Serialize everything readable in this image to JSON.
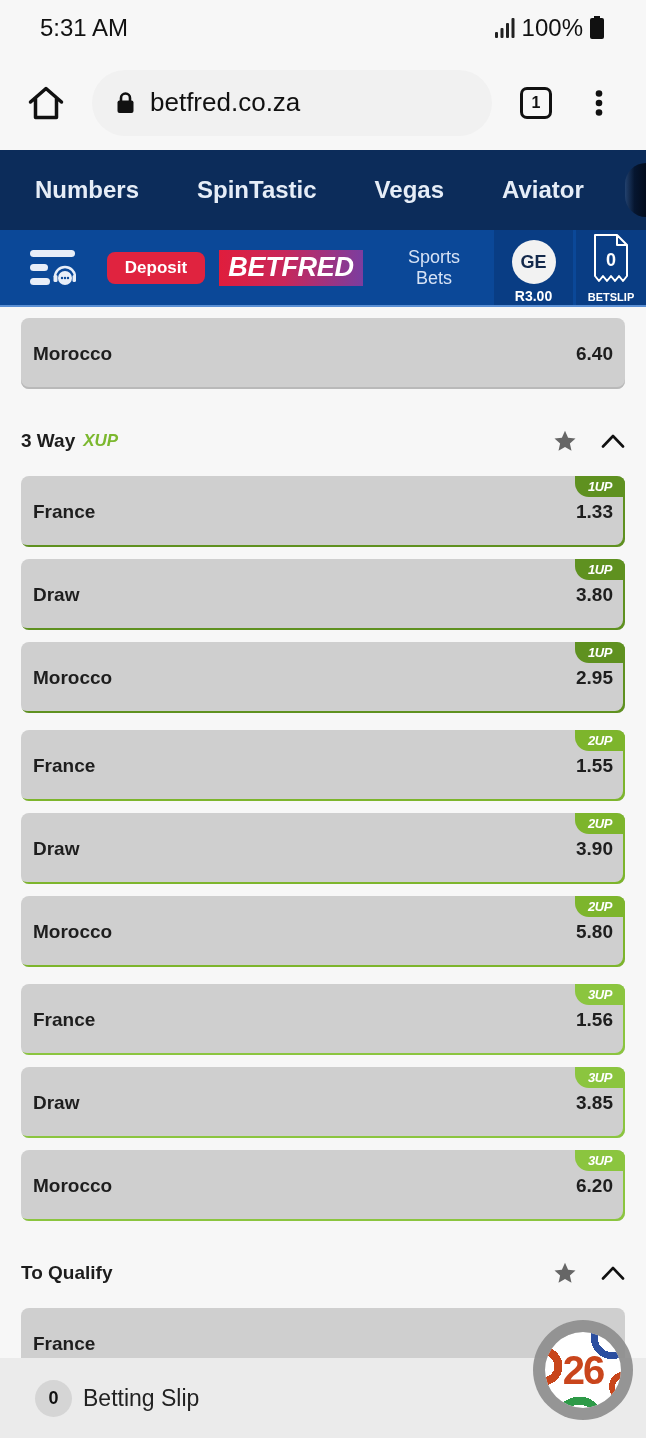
{
  "status_bar": {
    "time": "5:31 AM",
    "battery": "100%"
  },
  "browser": {
    "url": "betfred.co.za",
    "tab_count": "1"
  },
  "top_nav": {
    "items": [
      "Numbers",
      "SpinTastic",
      "Vegas",
      "Aviator"
    ]
  },
  "site_header": {
    "deposit": "Deposit",
    "logo": "BETFRED",
    "sports_link": "Sports Bets",
    "account_initials": "GE",
    "balance": "R3.00",
    "betslip_count": "0",
    "betslip_label": "BETSLIP"
  },
  "markets": [
    {
      "groups": [
        {
          "rows": [
            {
              "name": "Morocco",
              "odds": "6.40"
            }
          ]
        }
      ]
    },
    {
      "title": "3 Way",
      "tag": "XUP",
      "favorite": false,
      "expanded": true,
      "groups": [
        {
          "rows": [
            {
              "name": "France",
              "odds": "1.33",
              "badge": "1UP",
              "color": "#5f9120"
            },
            {
              "name": "Draw",
              "odds": "3.80",
              "badge": "1UP",
              "color": "#5f9120"
            },
            {
              "name": "Morocco",
              "odds": "2.95",
              "badge": "1UP",
              "color": "#5f9120"
            }
          ]
        },
        {
          "rows": [
            {
              "name": "France",
              "odds": "1.55",
              "badge": "2UP",
              "color": "#7db52c"
            },
            {
              "name": "Draw",
              "odds": "3.90",
              "badge": "2UP",
              "color": "#7db52c"
            },
            {
              "name": "Morocco",
              "odds": "5.80",
              "badge": "2UP",
              "color": "#7db52c"
            }
          ]
        },
        {
          "rows": [
            {
              "name": "France",
              "odds": "1.56",
              "badge": "3UP",
              "color": "#8bc53f"
            },
            {
              "name": "Draw",
              "odds": "3.85",
              "badge": "3UP",
              "color": "#8bc53f"
            },
            {
              "name": "Morocco",
              "odds": "6.20",
              "badge": "3UP",
              "color": "#8bc53f"
            }
          ]
        }
      ]
    },
    {
      "title": "To Qualify",
      "favorite": false,
      "expanded": true,
      "groups": [
        {
          "rows": [
            {
              "name": "France"
            }
          ]
        }
      ]
    }
  ],
  "betting_slip_bar": {
    "count": "0",
    "label": "Betting Slip"
  },
  "promo_button": {
    "label": "26"
  }
}
